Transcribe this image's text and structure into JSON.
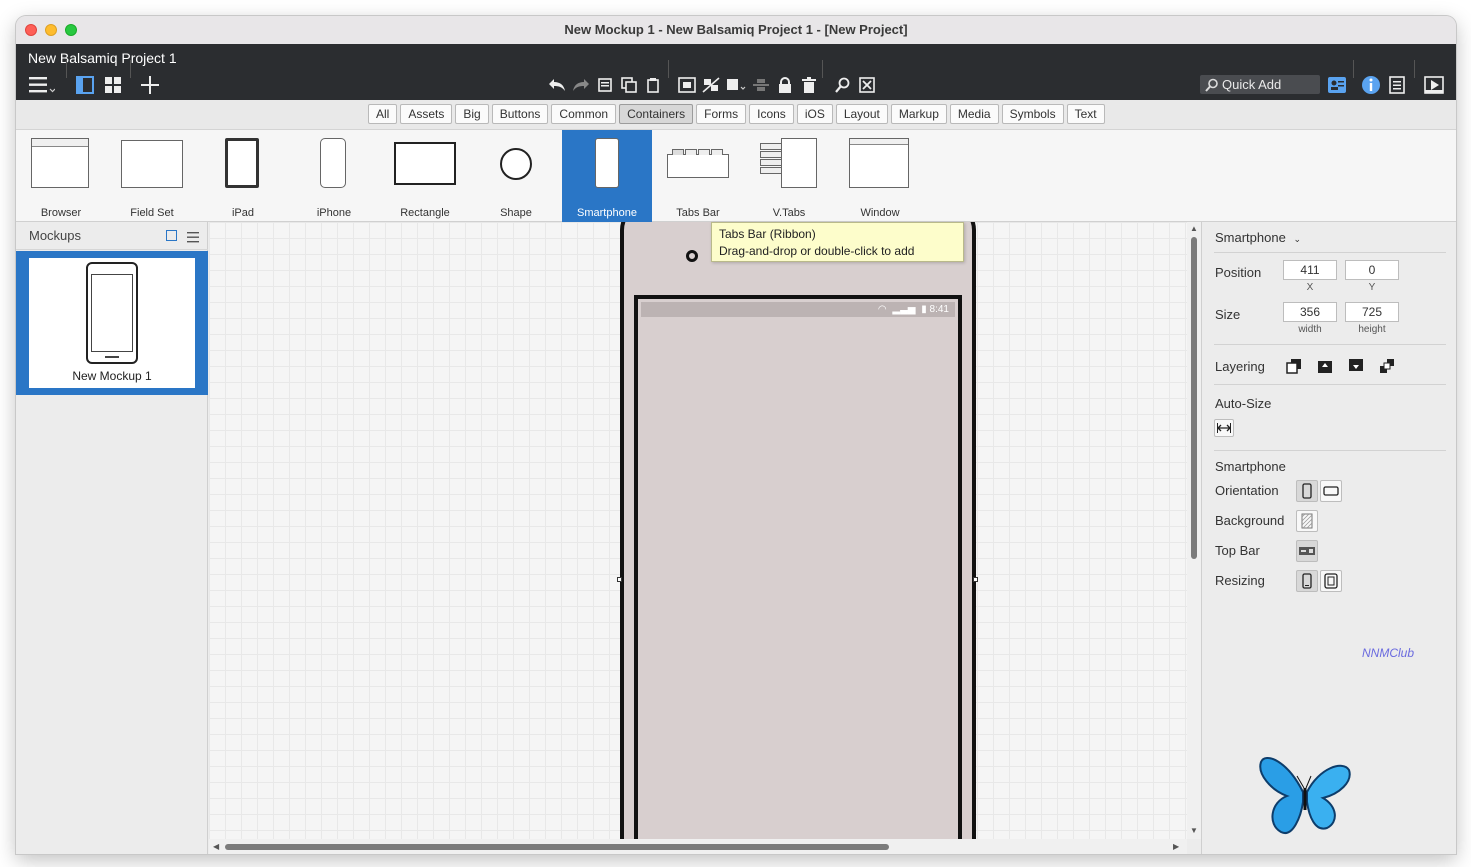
{
  "window": {
    "title": "New Mockup 1 - New Balsamiq Project 1 - [New Project]"
  },
  "app": {
    "project_title": "New Balsamiq Project 1"
  },
  "toolbar": {
    "quick_add": "Quick Add"
  },
  "filters": [
    "All",
    "Assets",
    "Big",
    "Buttons",
    "Common",
    "Containers",
    "Forms",
    "Icons",
    "iOS",
    "Layout",
    "Markup",
    "Media",
    "Symbols",
    "Text"
  ],
  "active_filter": "Containers",
  "components": {
    "browser": "Browser",
    "field_set": "Field Set",
    "ipad": "iPad",
    "iphone": "iPhone",
    "rectangle": "Rectangle",
    "shape": "Shape",
    "smartphone": "Smartphone",
    "tabs_bar": "Tabs Bar",
    "vtabs": "V.Tabs",
    "window": "Window"
  },
  "tooltip": {
    "title": "Tabs Bar (Ribbon)",
    "hint": "Drag-and-drop or double-click to add"
  },
  "mockups_panel": {
    "title": "Mockups",
    "items": [
      {
        "name": "New Mockup 1"
      }
    ]
  },
  "canvas": {
    "status_time": "8:41"
  },
  "properties": {
    "selected_type": "Smartphone",
    "position_label": "Position",
    "x": "411",
    "y": "0",
    "x_label": "X",
    "y_label": "Y",
    "size_label": "Size",
    "width": "356",
    "height": "725",
    "width_label": "width",
    "height_label": "height",
    "layering_label": "Layering",
    "autosize_label": "Auto-Size",
    "section_title": "Smartphone",
    "orientation_label": "Orientation",
    "background_label": "Background",
    "topbar_label": "Top Bar",
    "resizing_label": "Resizing"
  },
  "watermark": {
    "text": "NNMClub"
  },
  "colors": {
    "selection_blue": "#2a76c6",
    "appbar": "#2b2d30",
    "tooltip_bg": "#fdfdcb",
    "phone_screen": "#d8cfcf"
  }
}
